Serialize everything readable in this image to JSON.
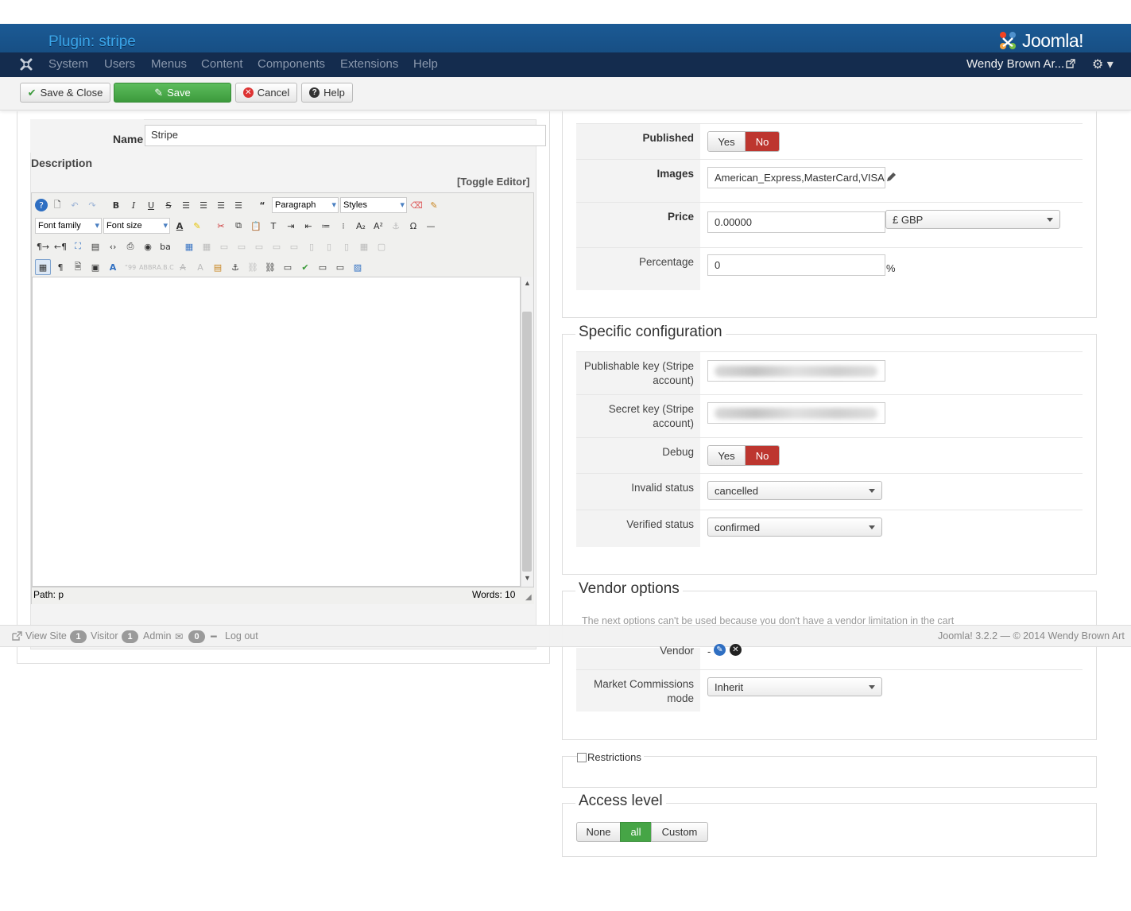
{
  "header": {
    "page_title": "Plugin: stripe",
    "brand": "Joomla!",
    "nav": [
      "System",
      "Users",
      "Menus",
      "Content",
      "Components",
      "Extensions",
      "Help"
    ],
    "user": "Wendy Brown Ar..."
  },
  "toolbar": {
    "save_close": "Save & Close",
    "save": "Save",
    "cancel": "Cancel",
    "help": "Help"
  },
  "left": {
    "name_label": "Name",
    "name_value": "Stripe",
    "description_label": "Description",
    "toggle_editor": "[Toggle Editor]",
    "editor": {
      "paragraph": "Paragraph",
      "styles": "Styles",
      "font_family": "Font family",
      "font_size": "Font size",
      "path_label": "Path:",
      "path_value": "p",
      "words": "Words: 10"
    }
  },
  "right": {
    "published_label": "Published",
    "yes": "Yes",
    "no": "No",
    "images_label": "Images",
    "images_value": "American_Express,MasterCard,VISA",
    "price_label": "Price",
    "price_value": "0.00000",
    "currency": "£ GBP",
    "percentage_label": "Percentage",
    "percentage_value": "0",
    "percent_sign": "%",
    "specific_title": "Specific configuration",
    "publishable_label": "Publishable key (Stripe account)",
    "secret_label": "Secret key (Stripe account)",
    "debug_label": "Debug",
    "invalid_label": "Invalid status",
    "invalid_value": "cancelled",
    "verified_label": "Verified status",
    "verified_value": "confirmed",
    "vendor_title": "Vendor options",
    "vendor_note": "The next options can't be used because you don't have a vendor limitation in the cart",
    "vendor_label": "Vendor",
    "vendor_value": "-",
    "market_label": "Market Commissions mode",
    "market_value": "Inherit",
    "restrictions_label": "Restrictions",
    "access_title": "Access level",
    "access_none": "None",
    "access_all": "all",
    "access_custom": "Custom"
  },
  "status": {
    "view_site": "View Site",
    "visitor_count": "1",
    "visitor": "Visitor",
    "admin_count": "1",
    "admin": "Admin",
    "msg_count": "0",
    "logout": "Log out",
    "copyright": "Joomla! 3.2.2 — © 2014 Wendy Brown Art"
  },
  "colors": {
    "header_bg": "#1b5a95",
    "navbar_bg": "#142c4e",
    "save_green": "#46a546",
    "no_red": "#bd362f",
    "all_green": "#46a546"
  }
}
